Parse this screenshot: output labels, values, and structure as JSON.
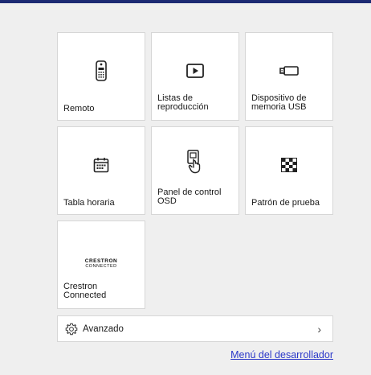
{
  "tiles": [
    {
      "label": "Remoto",
      "icon": "remote-icon"
    },
    {
      "label": "Listas de\nreproducción",
      "icon": "play-icon"
    },
    {
      "label": "Dispositivo de\nmemoria USB",
      "icon": "usb-icon"
    },
    {
      "label": "Tabla horaria",
      "icon": "calendar-icon"
    },
    {
      "label": "Panel de control\nOSD",
      "icon": "touch-panel-icon"
    },
    {
      "label": "Patrón de prueba",
      "icon": "test-pattern-icon"
    },
    {
      "label": "Crestron\nConnected",
      "icon": "crestron-logo",
      "logo_text": [
        "CRESTRON",
        "CONNECTED"
      ]
    }
  ],
  "advanced": {
    "label": "Avanzado",
    "icon": "gear-icon"
  },
  "developer_link": "Menú del desarrollador",
  "colors": {
    "accent_bar": "#1c2a73",
    "link": "#2b38c9",
    "background": "#efefef"
  }
}
